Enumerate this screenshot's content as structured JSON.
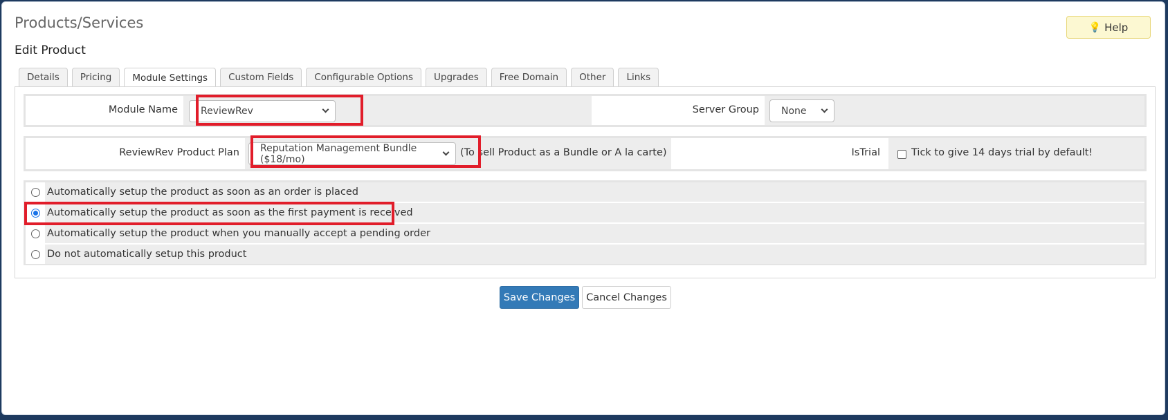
{
  "header": {
    "page_title": "Products/Services",
    "sub_title": "Edit Product",
    "help_label": "Help"
  },
  "tabs": [
    {
      "label": "Details"
    },
    {
      "label": "Pricing"
    },
    {
      "label": "Module Settings",
      "active": true
    },
    {
      "label": "Custom Fields"
    },
    {
      "label": "Configurable Options"
    },
    {
      "label": "Upgrades"
    },
    {
      "label": "Free Domain"
    },
    {
      "label": "Other"
    },
    {
      "label": "Links"
    }
  ],
  "module": {
    "module_name_label": "Module Name",
    "module_name_value": "ReviewRev",
    "server_group_label": "Server Group",
    "server_group_value": "None",
    "plan_label": "ReviewRev Product Plan",
    "plan_value": "Reputation Management Bundle ($18/mo)",
    "plan_note": "(To sell Product as a Bundle or A la carte)",
    "istrial_label": "IsTrial",
    "istrial_text": "Tick to give 14 days trial by default!",
    "istrial_checked": false
  },
  "setup_options": [
    {
      "label": "Automatically setup the product as soon as an order is placed",
      "selected": false
    },
    {
      "label": "Automatically setup the product as soon as the first payment is received",
      "selected": true
    },
    {
      "label": "Automatically setup the product when you manually accept a pending order",
      "selected": false
    },
    {
      "label": "Do not automatically setup this product",
      "selected": false
    }
  ],
  "actions": {
    "save_label": "Save Changes",
    "cancel_label": "Cancel Changes"
  },
  "colors": {
    "highlight": "#e11d2a",
    "primary": "#337ab7",
    "help_bg": "#fcf8d2"
  }
}
